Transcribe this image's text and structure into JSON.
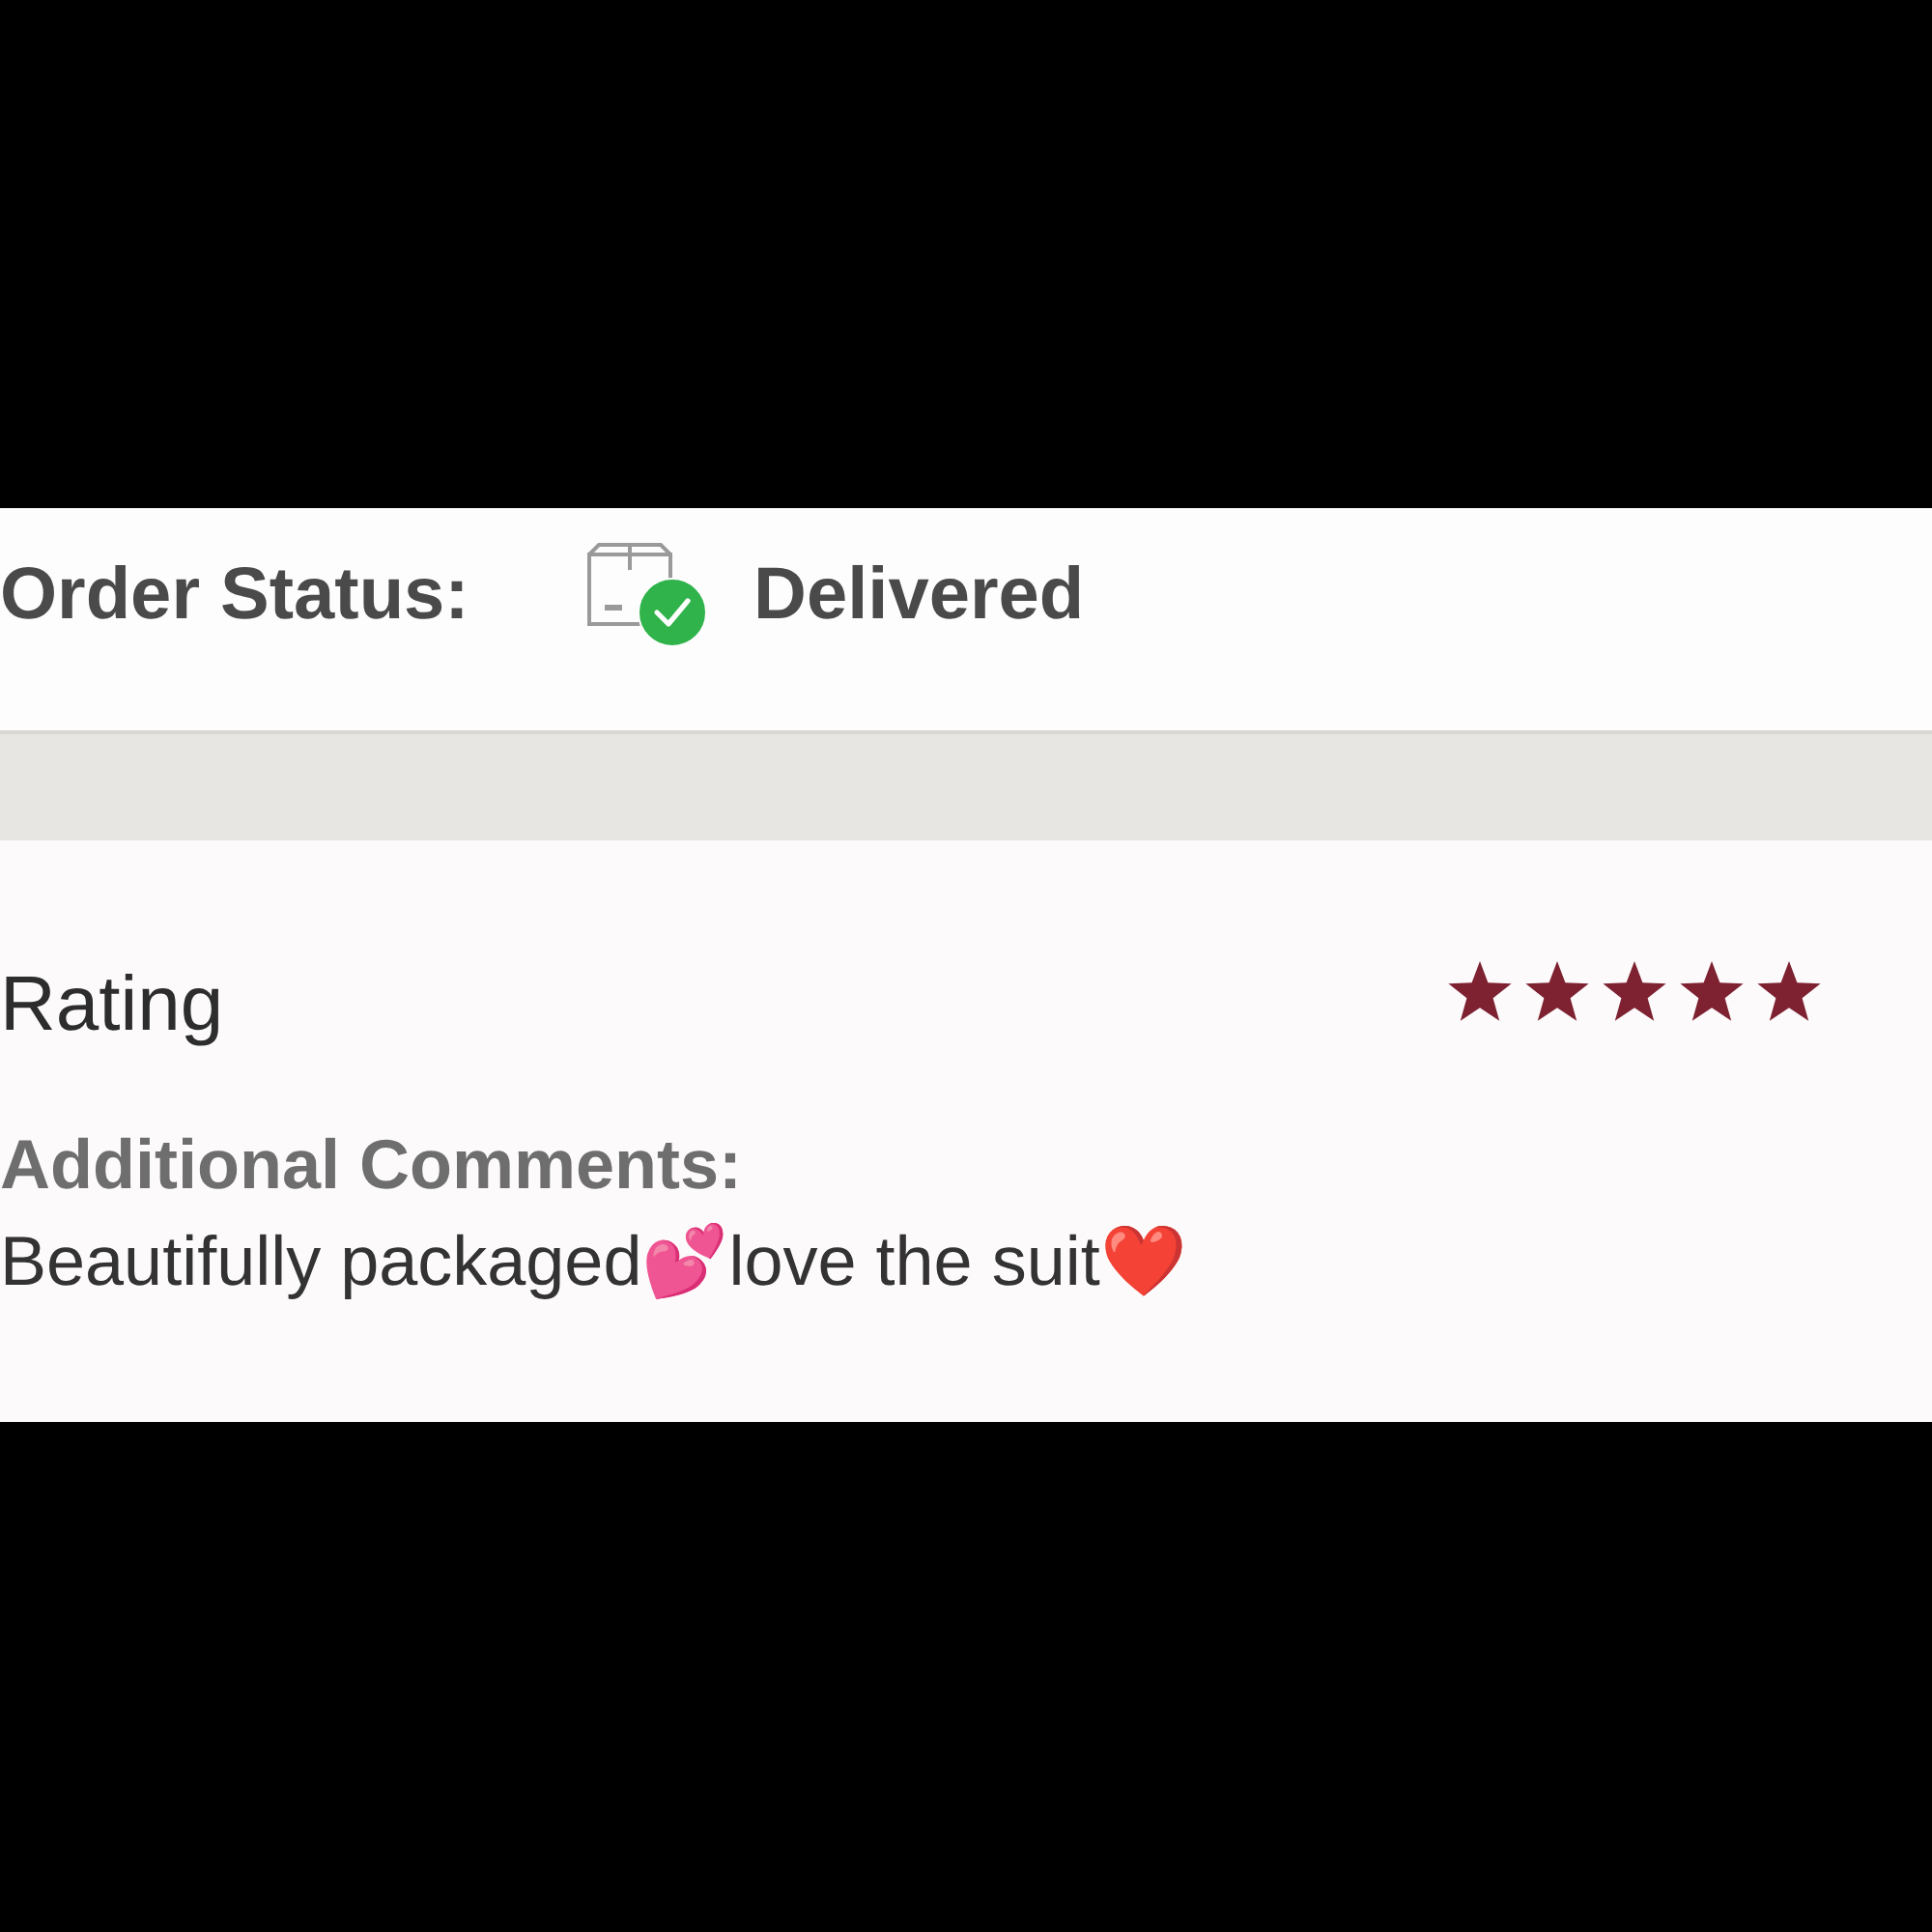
{
  "order_status": {
    "label": "Order Status:",
    "value": "Delivered"
  },
  "rating": {
    "label": "Rating",
    "stars": 5
  },
  "comments": {
    "label": "Additional Comments:",
    "text": "Beautifully packaged💕love the suit❤️"
  }
}
